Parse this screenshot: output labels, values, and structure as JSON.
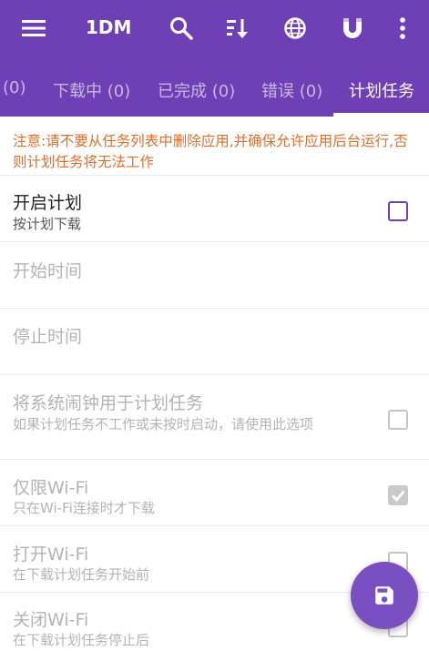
{
  "app": {
    "title": "1DM"
  },
  "toolbar": {
    "icons": [
      "menu-icon",
      "search-icon",
      "sort-icon",
      "browser-globe-icon",
      "magnet-icon",
      "more-vert-icon"
    ]
  },
  "tabs": [
    {
      "label": "(0)",
      "active": false
    },
    {
      "label": "下载中 (0)",
      "active": false
    },
    {
      "label": "已完成 (0)",
      "active": false
    },
    {
      "label": "错误 (0)",
      "active": false
    },
    {
      "label": "计划任务",
      "active": true
    }
  ],
  "notice": {
    "text": "注意:请不要从任务列表中删除应用,并确保允许应用后台运行,否则计划任务将无法工作"
  },
  "settings": [
    {
      "title": "开启计划",
      "subtitle": "按计划下载",
      "checkbox": "unchecked"
    },
    {
      "title": "开始时间",
      "subtitle": ""
    },
    {
      "title": "停止时间",
      "subtitle": ""
    },
    {
      "title": "将系统闹钟用于计划任务",
      "subtitle": "如果计划任务不工作或未按时启动，请使用此选项",
      "checkbox": "unchecked"
    },
    {
      "title": "仅限Wi-Fi",
      "subtitle": "只在Wi-Fi连接时才下载",
      "checkbox": "checked"
    },
    {
      "title": "打开Wi-Fi",
      "subtitle": "在下载计划任务开始前",
      "checkbox": "unchecked"
    },
    {
      "title": "关闭Wi-Fi",
      "subtitle": "在下载计划任务停止后",
      "checkbox": "unchecked"
    }
  ],
  "fab": {
    "icon": "save-icon"
  },
  "colors": {
    "primary": "#6f3fb6",
    "notice": "#e46d2a",
    "fab": "#7a4fc1"
  }
}
